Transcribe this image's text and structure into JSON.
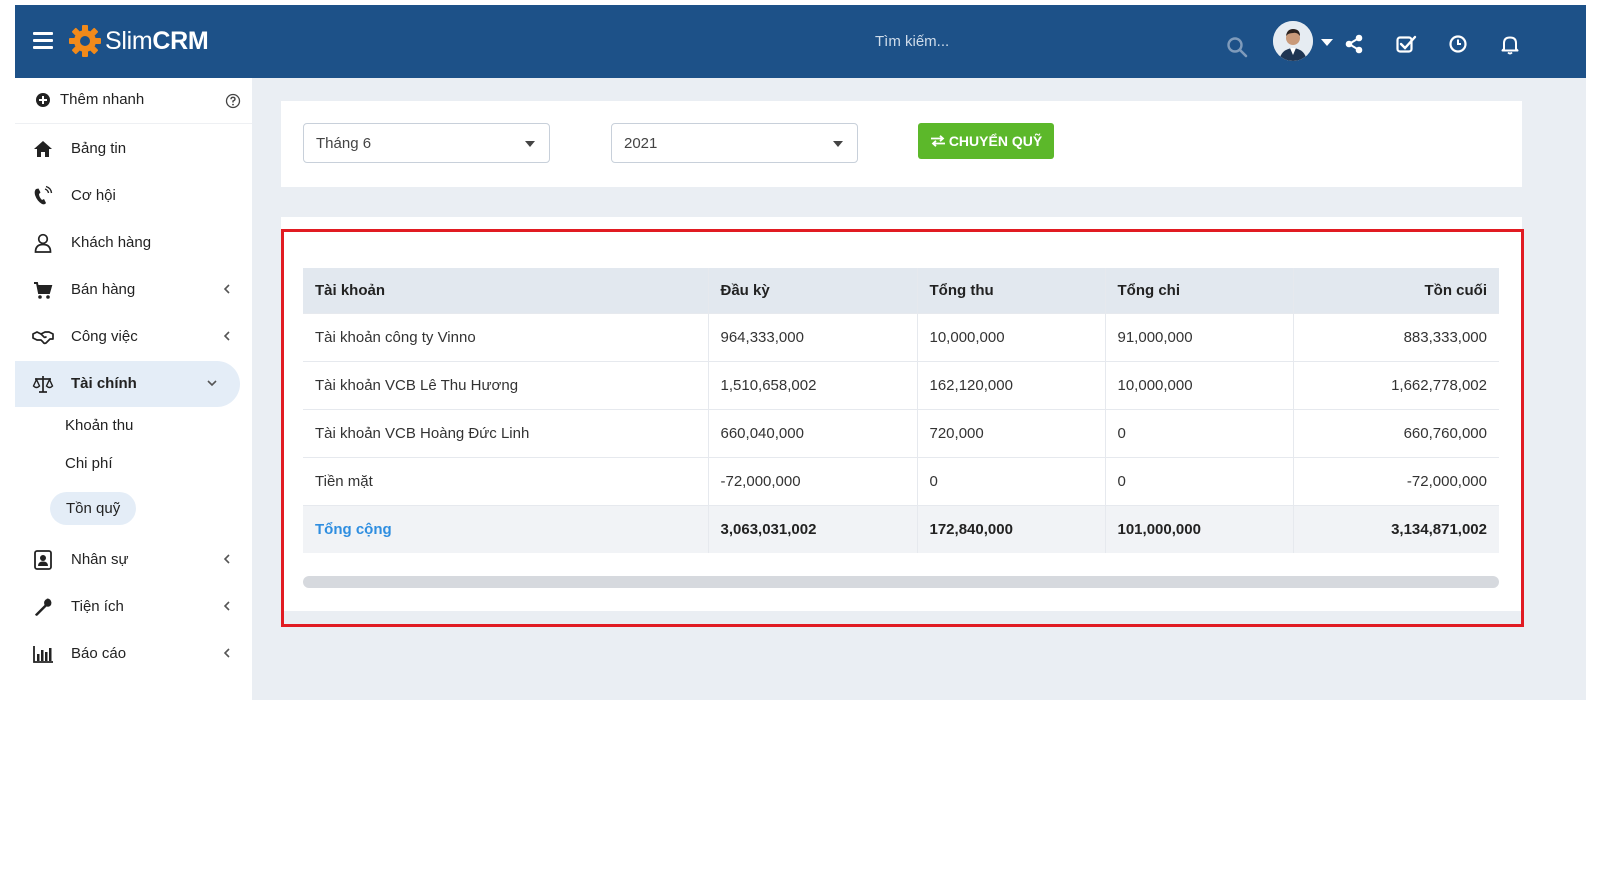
{
  "header": {
    "logo_light": "Slim",
    "logo_bold": "CRM",
    "search_placeholder": "Tìm kiếm..."
  },
  "sidebar": {
    "quick_add": "Thêm nhanh",
    "items": [
      {
        "label": "Bảng tin",
        "icon": "home-icon"
      },
      {
        "label": "Cơ hội",
        "icon": "phone-icon"
      },
      {
        "label": "Khách hàng",
        "icon": "user-icon"
      },
      {
        "label": "Bán hàng",
        "icon": "cart-icon"
      },
      {
        "label": "Công việc",
        "icon": "handshake-icon"
      },
      {
        "label": "Tài chính",
        "icon": "scale-icon"
      },
      {
        "label": "Nhân sự",
        "icon": "id-card-icon"
      },
      {
        "label": "Tiện ích",
        "icon": "wrench-icon"
      },
      {
        "label": "Báo cáo",
        "icon": "bar-chart-icon"
      }
    ],
    "finance_sub": [
      "Khoản thu",
      "Chi phí",
      "Tồn quỹ"
    ]
  },
  "filters": {
    "month": "Tháng 6",
    "year": "2021",
    "transfer_button": "CHUYỂN QUỸ"
  },
  "table": {
    "headers": [
      "Tài khoản",
      "Đầu kỳ",
      "Tổng thu",
      "Tổng chi",
      "Tồn cuối"
    ],
    "rows": [
      [
        "Tài khoản công ty Vinno",
        "964,333,000",
        "10,000,000",
        "91,000,000",
        "883,333,000"
      ],
      [
        "Tài khoản VCB Lê Thu Hương",
        "1,510,658,002",
        "162,120,000",
        "10,000,000",
        "1,662,778,002"
      ],
      [
        "Tài khoản VCB Hoàng Đức Linh",
        "660,040,000",
        "720,000",
        "0",
        "660,760,000"
      ],
      [
        "Tiền mặt",
        "-72,000,000",
        "0",
        "0",
        "-72,000,000"
      ]
    ],
    "total": [
      "Tổng cộng",
      "3,063,031,002",
      "172,840,000",
      "101,000,000",
      "3,134,871,002"
    ]
  },
  "colors": {
    "header_bg": "#1d5188",
    "accent_orange": "#f28a1a",
    "button_green": "#5cb82a",
    "link_blue": "#2f8ee0",
    "highlight_red": "#e11b22"
  }
}
